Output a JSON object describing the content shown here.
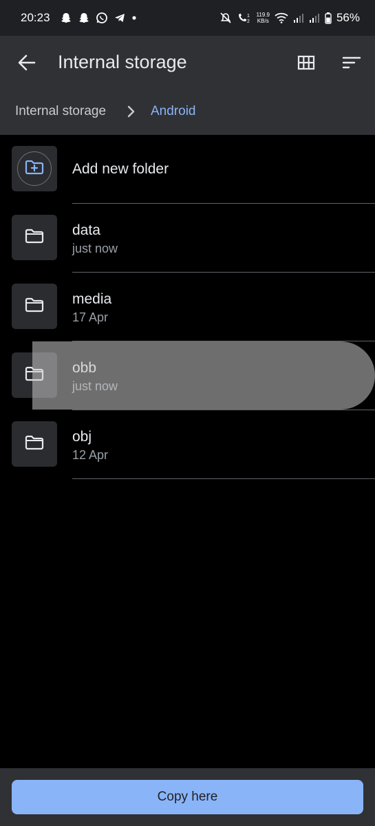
{
  "status_bar": {
    "time": "20:23",
    "net_speed_value": "119.9",
    "net_speed_unit": "KB/s",
    "battery": "56%",
    "notification_icons": [
      "snapchat-icon",
      "snapchat-icon",
      "whatsapp-icon",
      "telegram-icon",
      "dot-icon"
    ],
    "system_icons": [
      "mute-icon",
      "volte-icon",
      "wifi-icon",
      "signal-icon",
      "signal-icon",
      "battery-icon"
    ]
  },
  "app_bar": {
    "title": "Internal storage",
    "back_icon": "arrow-back-icon",
    "grid_icon": "grid-view-icon",
    "sort_icon": "sort-icon"
  },
  "breadcrumb": {
    "root": "Internal storage",
    "current": "Android"
  },
  "add_folder": {
    "label": "Add new folder"
  },
  "folders": [
    {
      "name": "data",
      "date": "just now"
    },
    {
      "name": "media",
      "date": "17 Apr"
    },
    {
      "name": "obb",
      "date": "just now"
    },
    {
      "name": "obj",
      "date": "12 Apr"
    }
  ],
  "bottom": {
    "copy_label": "Copy here"
  },
  "colors": {
    "accent": "#8ab4f8",
    "surface": "#303134",
    "background": "#000000"
  }
}
